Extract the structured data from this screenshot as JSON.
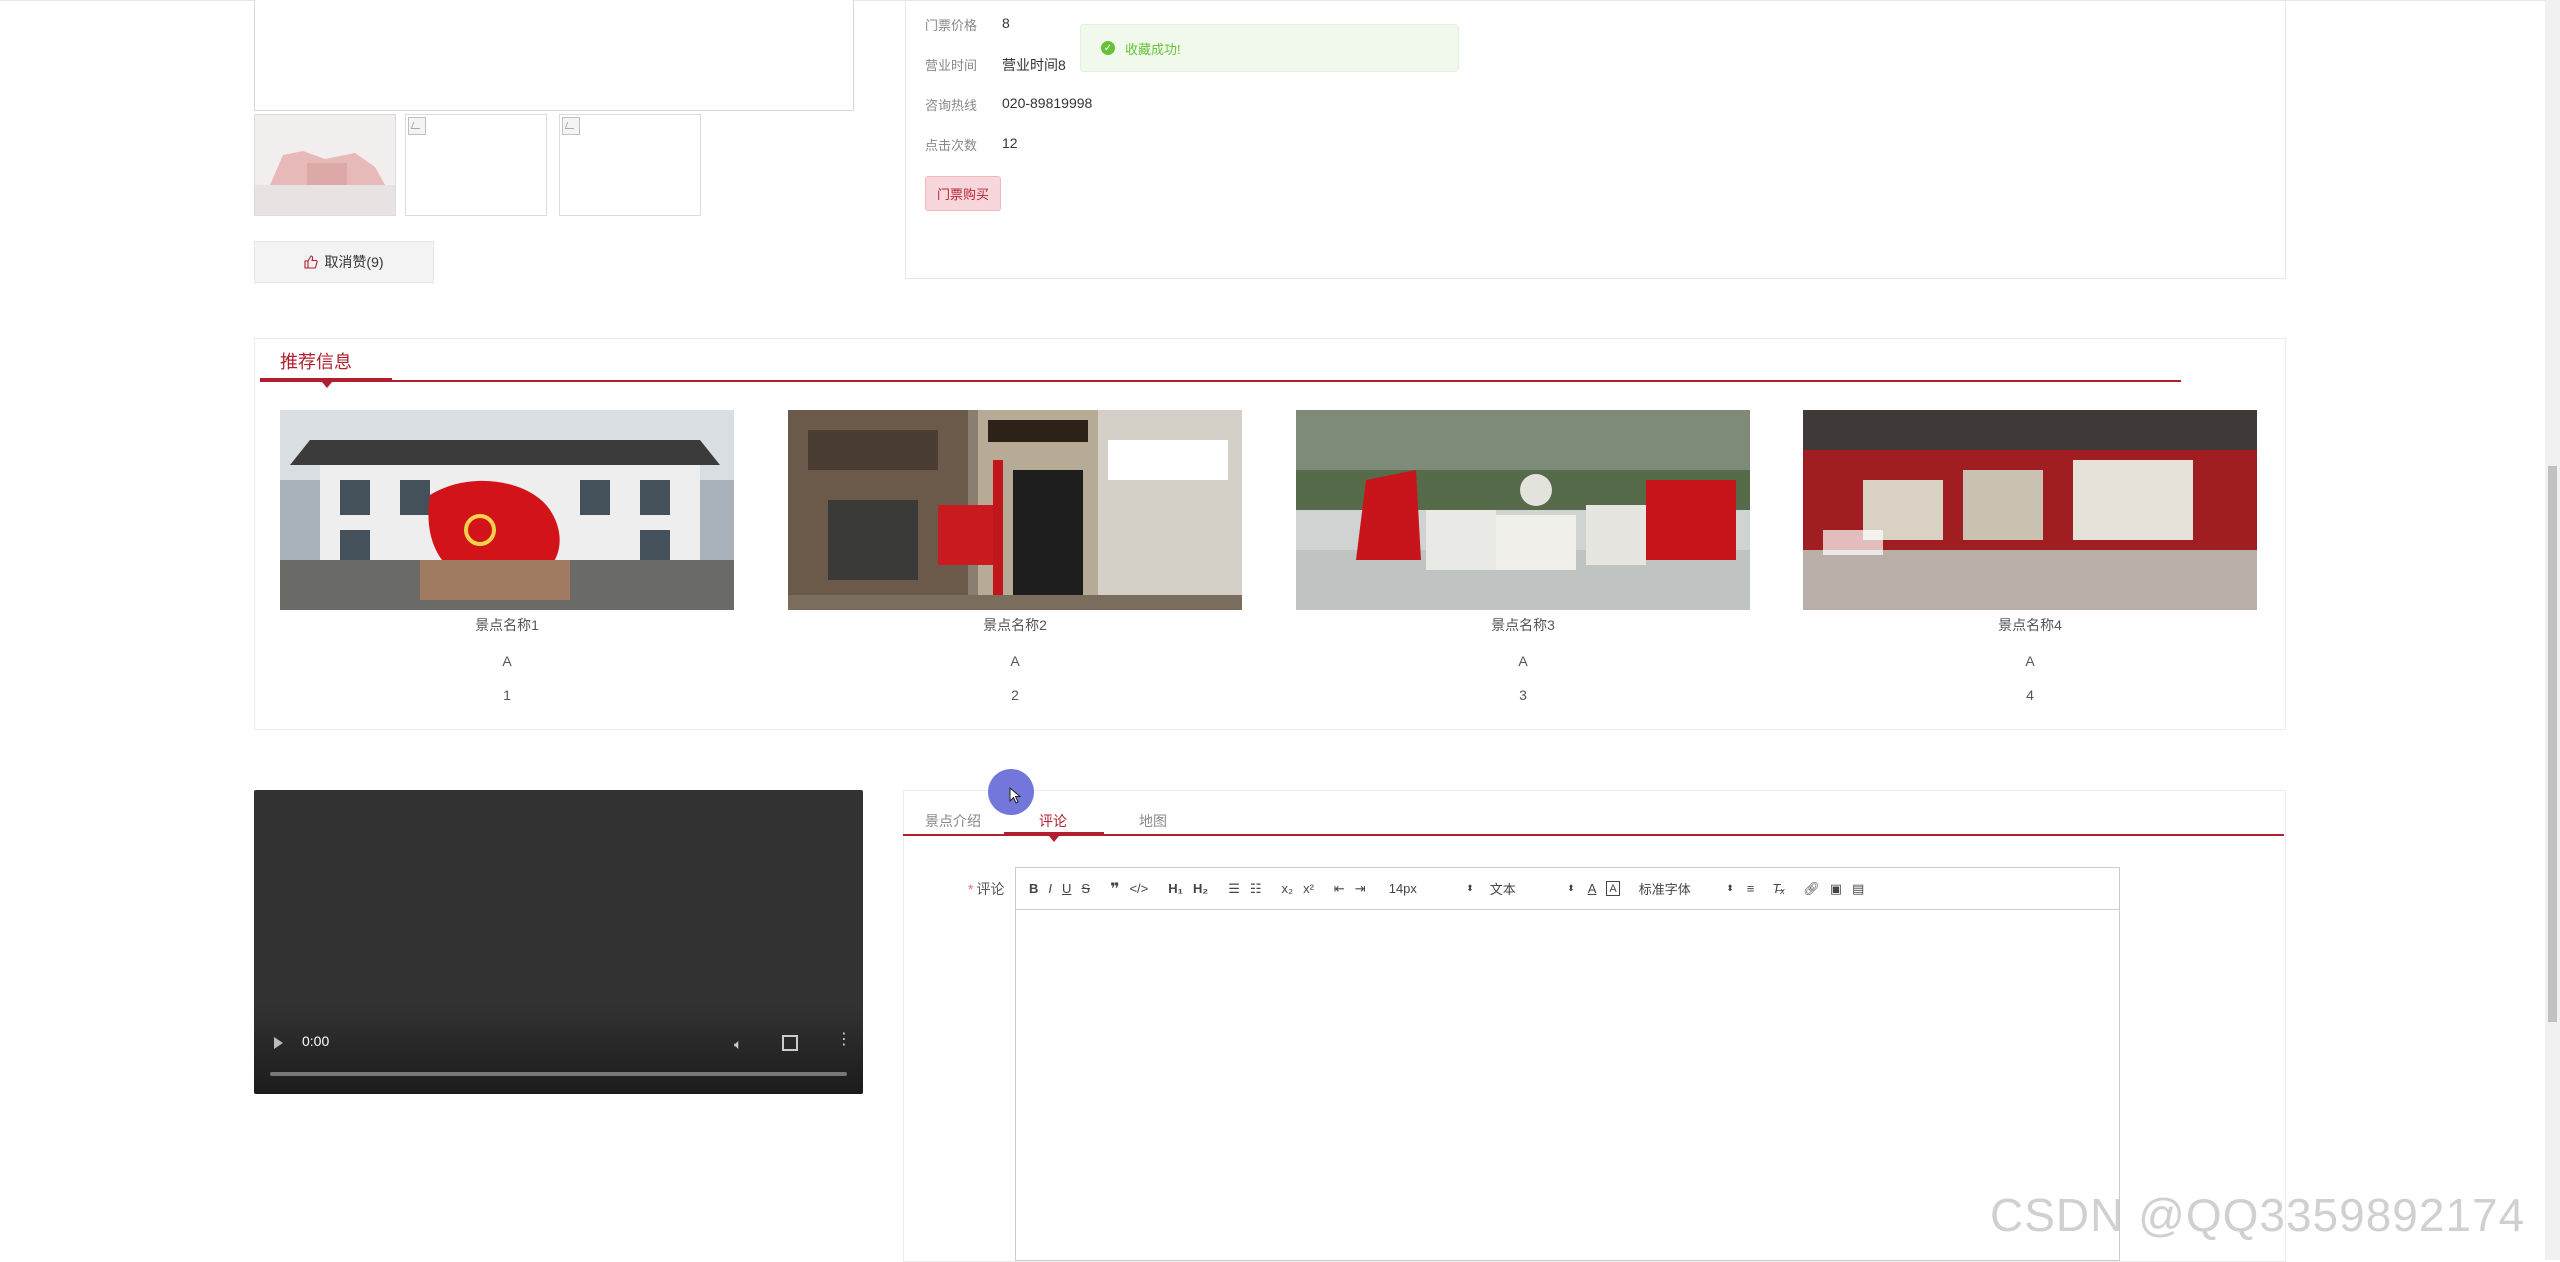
{
  "info": {
    "rows": [
      {
        "label": "门票价格",
        "value": "8"
      },
      {
        "label": "营业时间",
        "value": "营业时间8"
      },
      {
        "label": "咨询热线",
        "value": "020-89819998"
      },
      {
        "label": "点击次数",
        "value": "12"
      }
    ],
    "buy_label": "门票购买"
  },
  "toast": {
    "text": "收藏成功!"
  },
  "like": {
    "label": "取消赞(9)"
  },
  "recommend": {
    "title": "推荐信息",
    "items": [
      {
        "name": "景点名称1",
        "level": "A",
        "num": "1"
      },
      {
        "name": "景点名称2",
        "level": "A",
        "num": "2"
      },
      {
        "name": "景点名称3",
        "level": "A",
        "num": "3"
      },
      {
        "name": "景点名称4",
        "level": "A",
        "num": "4"
      }
    ]
  },
  "video": {
    "time": "0:00"
  },
  "tabs": [
    {
      "label": "景点介绍",
      "active": false
    },
    {
      "label": "评论",
      "active": true
    },
    {
      "label": "地图",
      "active": false
    }
  ],
  "comment": {
    "required_mark": "*",
    "label": "评论",
    "size_select": "14px",
    "header_select": "文本",
    "font_select": "标准字体"
  },
  "watermark": "CSDN @QQ3359892174",
  "colors": {
    "accent": "#b11f2f",
    "success": "#67c23a"
  }
}
